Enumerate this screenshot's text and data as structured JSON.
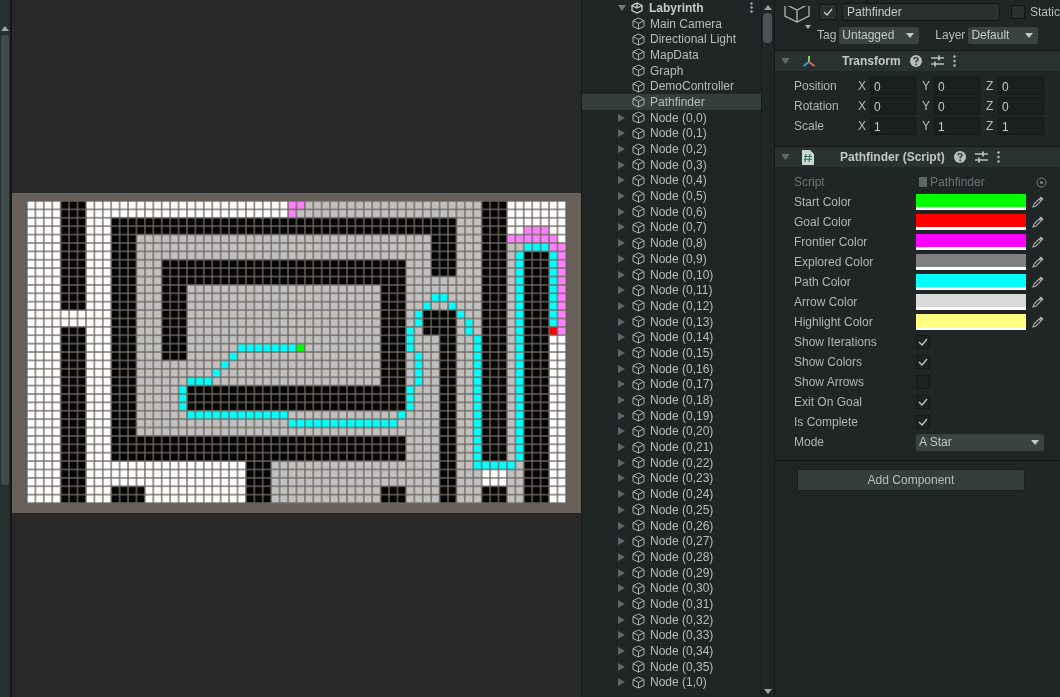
{
  "hierarchy": {
    "scene": {
      "name": "Labyrinth",
      "expanded": true
    },
    "items": [
      {
        "label": "Main Camera",
        "kind": "leaf",
        "selected": false
      },
      {
        "label": "Directional Light",
        "kind": "leaf",
        "selected": false
      },
      {
        "label": "MapData",
        "kind": "leaf",
        "selected": false
      },
      {
        "label": "Graph",
        "kind": "leaf",
        "selected": false
      },
      {
        "label": "DemoController",
        "kind": "leaf",
        "selected": false
      },
      {
        "label": "Pathfinder",
        "kind": "leaf",
        "selected": true
      },
      {
        "label": "Node (0,0)",
        "kind": "group",
        "expanded": false,
        "selected": false
      },
      {
        "label": "Node (0,1)",
        "kind": "group",
        "expanded": false,
        "selected": false
      },
      {
        "label": "Node (0,2)",
        "kind": "group",
        "expanded": false,
        "selected": false
      },
      {
        "label": "Node (0,3)",
        "kind": "group",
        "expanded": false,
        "selected": false
      },
      {
        "label": "Node (0,4)",
        "kind": "group",
        "expanded": false,
        "selected": false
      },
      {
        "label": "Node (0,5)",
        "kind": "group",
        "expanded": false,
        "selected": false
      },
      {
        "label": "Node (0,6)",
        "kind": "group",
        "expanded": false,
        "selected": false
      },
      {
        "label": "Node (0,7)",
        "kind": "group",
        "expanded": false,
        "selected": false
      },
      {
        "label": "Node (0,8)",
        "kind": "group",
        "expanded": false,
        "selected": false
      },
      {
        "label": "Node (0,9)",
        "kind": "group",
        "expanded": false,
        "selected": false
      },
      {
        "label": "Node (0,10)",
        "kind": "group",
        "expanded": false,
        "selected": false
      },
      {
        "label": "Node (0,11)",
        "kind": "group",
        "expanded": false,
        "selected": false
      },
      {
        "label": "Node (0,12)",
        "kind": "group",
        "expanded": false,
        "selected": false
      },
      {
        "label": "Node (0,13)",
        "kind": "group",
        "expanded": false,
        "selected": false
      },
      {
        "label": "Node (0,14)",
        "kind": "group",
        "expanded": false,
        "selected": false
      },
      {
        "label": "Node (0,15)",
        "kind": "group",
        "expanded": false,
        "selected": false
      },
      {
        "label": "Node (0,16)",
        "kind": "group",
        "expanded": false,
        "selected": false
      },
      {
        "label": "Node (0,17)",
        "kind": "group",
        "expanded": false,
        "selected": false
      },
      {
        "label": "Node (0,18)",
        "kind": "group",
        "expanded": false,
        "selected": false
      },
      {
        "label": "Node (0,19)",
        "kind": "group",
        "expanded": false,
        "selected": false
      },
      {
        "label": "Node (0,20)",
        "kind": "group",
        "expanded": false,
        "selected": false
      },
      {
        "label": "Node (0,21)",
        "kind": "group",
        "expanded": false,
        "selected": false
      },
      {
        "label": "Node (0,22)",
        "kind": "group",
        "expanded": false,
        "selected": false
      },
      {
        "label": "Node (0,23)",
        "kind": "group",
        "expanded": false,
        "selected": false
      },
      {
        "label": "Node (0,24)",
        "kind": "group",
        "expanded": false,
        "selected": false
      },
      {
        "label": "Node (0,25)",
        "kind": "group",
        "expanded": false,
        "selected": false
      },
      {
        "label": "Node (0,26)",
        "kind": "group",
        "expanded": false,
        "selected": false
      },
      {
        "label": "Node (0,27)",
        "kind": "group",
        "expanded": false,
        "selected": false
      },
      {
        "label": "Node (0,28)",
        "kind": "group",
        "expanded": false,
        "selected": false
      },
      {
        "label": "Node (0,29)",
        "kind": "group",
        "expanded": false,
        "selected": false
      },
      {
        "label": "Node (0,30)",
        "kind": "group",
        "expanded": false,
        "selected": false
      },
      {
        "label": "Node (0,31)",
        "kind": "group",
        "expanded": false,
        "selected": false
      },
      {
        "label": "Node (0,32)",
        "kind": "group",
        "expanded": false,
        "selected": false
      },
      {
        "label": "Node (0,33)",
        "kind": "group",
        "expanded": false,
        "selected": false
      },
      {
        "label": "Node (0,34)",
        "kind": "group",
        "expanded": false,
        "selected": false
      },
      {
        "label": "Node (0,35)",
        "kind": "group",
        "expanded": false,
        "selected": false
      },
      {
        "label": "Node (1,0)",
        "kind": "group",
        "expanded": false,
        "selected": false
      }
    ]
  },
  "inspector": {
    "object": {
      "active": true,
      "name": "Pathfinder",
      "static_label": "Static",
      "static": false,
      "tag_label": "Tag",
      "tag": "Untagged",
      "layer_label": "Layer",
      "layer": "Default"
    },
    "components": [
      {
        "title": "Transform",
        "kind": "transform",
        "expanded": true,
        "rows": [
          {
            "label": "Position",
            "values": [
              {
                "axis": "X",
                "value": "0"
              },
              {
                "axis": "Y",
                "value": "0"
              },
              {
                "axis": "Z",
                "value": "0"
              }
            ]
          },
          {
            "label": "Rotation",
            "values": [
              {
                "axis": "X",
                "value": "0"
              },
              {
                "axis": "Y",
                "value": "0"
              },
              {
                "axis": "Z",
                "value": "0"
              }
            ]
          },
          {
            "label": "Scale",
            "values": [
              {
                "axis": "X",
                "value": "1"
              },
              {
                "axis": "Y",
                "value": "1"
              },
              {
                "axis": "Z",
                "value": "1"
              }
            ]
          }
        ]
      },
      {
        "title": "Pathfinder (Script)",
        "kind": "script",
        "expanded": true,
        "rows": [
          {
            "kind": "object",
            "label": "Script",
            "value": "Pathfinder",
            "disabled": true
          },
          {
            "kind": "color",
            "label": "Start Color",
            "color": "#00ff00",
            "disabled": false
          },
          {
            "kind": "color",
            "label": "Goal Color",
            "color": "#ff0000",
            "disabled": false
          },
          {
            "kind": "color",
            "label": "Frontier Color",
            "color": "#ff00ff",
            "disabled": false
          },
          {
            "kind": "color",
            "label": "Explored Color",
            "color": "#808080",
            "disabled": false
          },
          {
            "kind": "color",
            "label": "Path Color",
            "color": "#00ffff",
            "disabled": false
          },
          {
            "kind": "color",
            "label": "Arrow Color",
            "color": "#d9d9d9",
            "disabled": false
          },
          {
            "kind": "color",
            "label": "Highlight Color",
            "color": "#ffff80",
            "disabled": false
          },
          {
            "kind": "toggle",
            "label": "Show Iterations",
            "checked": true,
            "disabled": false
          },
          {
            "kind": "toggle",
            "label": "Show Colors",
            "checked": true,
            "disabled": false
          },
          {
            "kind": "toggle",
            "label": "Show Arrows",
            "checked": false,
            "disabled": false
          },
          {
            "kind": "toggle",
            "label": "Exit On Goal",
            "checked": true,
            "disabled": false
          },
          {
            "kind": "toggle",
            "label": "Is Complete",
            "checked": true,
            "disabled": false
          },
          {
            "kind": "enum",
            "label": "Mode",
            "value": "A Star",
            "disabled": false
          }
        ]
      }
    ],
    "add_component": "Add Component"
  }
}
